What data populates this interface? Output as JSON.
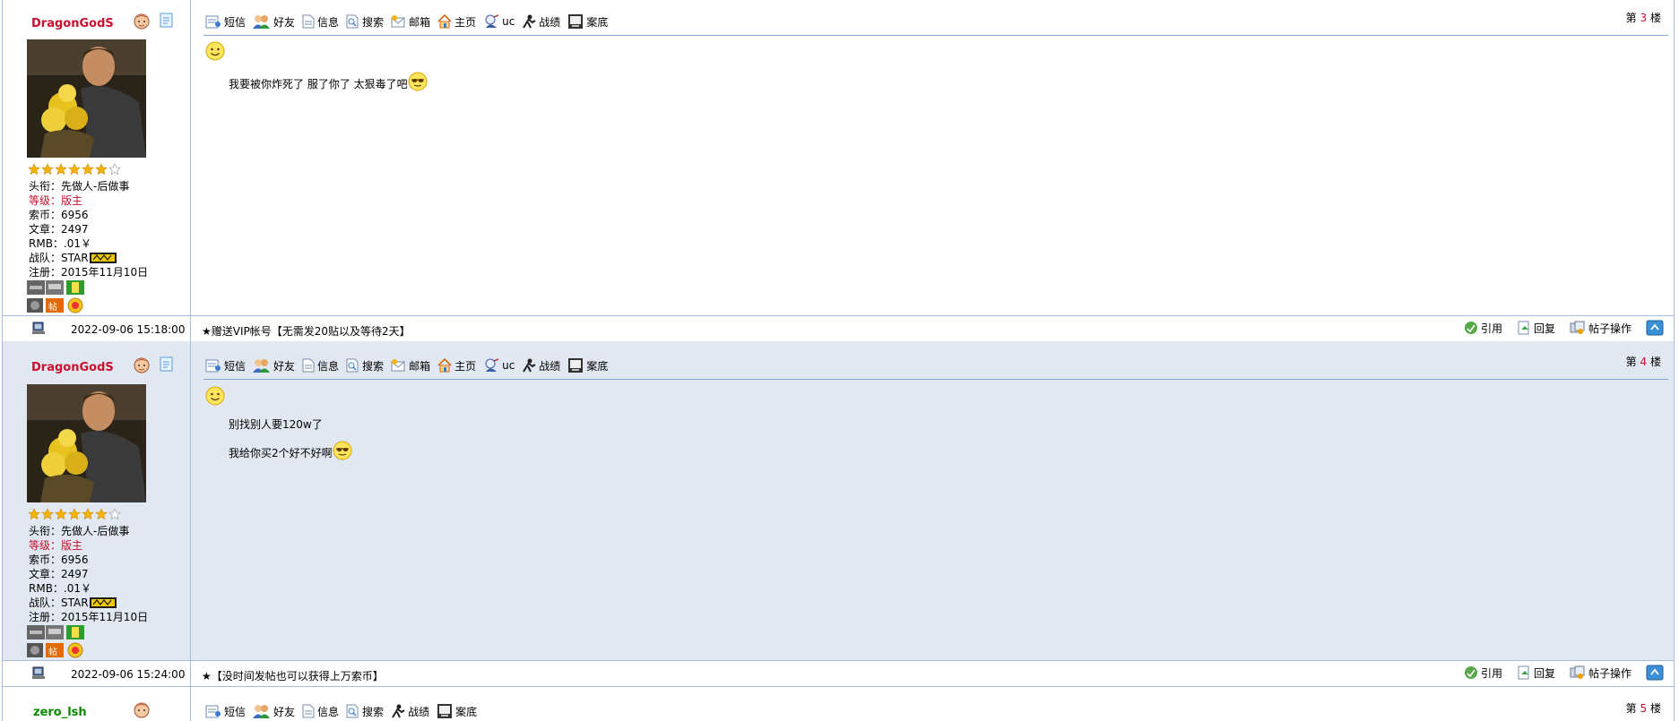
{
  "toolbar_full": [
    "短信",
    "好友",
    "信息",
    "搜索",
    "邮箱",
    "主页",
    "uc",
    "战绩",
    "案底"
  ],
  "toolbar_short": [
    "短信",
    "好友",
    "信息",
    "搜索",
    "战绩",
    "案底"
  ],
  "actions": [
    "引用",
    "回复",
    "帖子操作"
  ],
  "floor_prefix": "第",
  "floor_suffix": "楼",
  "posts": [
    {
      "username": "DragonGodS",
      "floor": "3",
      "profile": {
        "title": "头衔：先做人-后做事",
        "level": "等级：版主",
        "coins": "索币：6956",
        "articles": "文章：2497",
        "rmb": "RMB：.01￥",
        "team": "战队：STAR",
        "registered": "注册：2015年11月10日"
      },
      "lines": [
        "我要被你炸死了 服了你了 太狠毒了吧"
      ],
      "time": "2022-09-06 15:18:00",
      "signature": "★赠送VIP帐号【无需发20贴以及等待2天】"
    },
    {
      "username": "DragonGodS",
      "floor": "4",
      "profile": {
        "title": "头衔：先做人-后做事",
        "level": "等级：版主",
        "coins": "索币：6956",
        "articles": "文章：2497",
        "rmb": "RMB：.01￥",
        "team": "战队：STAR",
        "registered": "注册：2015年11月10日"
      },
      "lines": [
        "别找别人要120w了",
        "我给你买2个好不好啊"
      ],
      "time": "2022-09-06 15:24:00",
      "signature": "★【没时间发帖也可以获得上万索币】"
    },
    {
      "username": "zero_lsh",
      "floor": "5"
    }
  ],
  "colors": {
    "border": "#a7bce0",
    "shade": "#e2e8f1",
    "accent": "#c8102e",
    "green_name": "#0b8a00"
  }
}
